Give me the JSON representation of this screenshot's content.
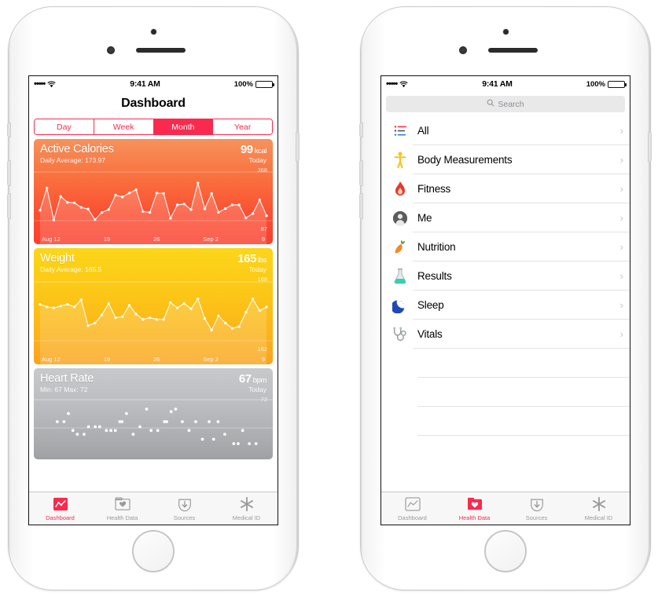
{
  "phones": {
    "left": {
      "status": {
        "signal_dots": "•••••",
        "time": "9:41 AM",
        "battery_pct": "100%"
      },
      "nav_title": "Dashboard",
      "segments": [
        {
          "label": "Day",
          "active": false
        },
        {
          "label": "Week",
          "active": false
        },
        {
          "label": "Month",
          "active": true
        },
        {
          "label": "Year",
          "active": false
        }
      ],
      "cards": [
        {
          "id": "active-calories",
          "title": "Active Calories",
          "subtitle": "Daily Average: 173.97",
          "value": "99",
          "unit": "kcal",
          "when": "Today",
          "axis_max": "368",
          "axis_min": "87",
          "x_ticks": [
            "Aug 12",
            "19",
            "26",
            "Sep 2",
            "9"
          ],
          "accent": "#fb4c31"
        },
        {
          "id": "weight",
          "title": "Weight",
          "subtitle": "Daily Average: 165.5",
          "value": "165",
          "unit": "lbs",
          "when": "Today",
          "axis_max": "168",
          "axis_min": "162",
          "x_ticks": [
            "Aug 12",
            "19",
            "26",
            "Sep 2",
            "9"
          ],
          "accent": "#fcc617"
        },
        {
          "id": "heart-rate",
          "title": "Heart Rate",
          "subtitle": "Min: 67  Max: 72",
          "value": "67",
          "unit": "bpm",
          "when": "Today",
          "axis_max": "72",
          "axis_min": "",
          "x_ticks": [],
          "accent": "#a8a9ac"
        }
      ],
      "tabs": [
        {
          "label": "Dashboard",
          "icon": "dashboard-chart-icon",
          "active": true
        },
        {
          "label": "Health Data",
          "icon": "health-data-folder-icon",
          "active": false
        },
        {
          "label": "Sources",
          "icon": "sources-download-icon",
          "active": false
        },
        {
          "label": "Medical ID",
          "icon": "medical-id-asterisk-icon",
          "active": false
        }
      ]
    },
    "right": {
      "status": {
        "signal_dots": "•••••",
        "time": "9:41 AM",
        "battery_pct": "100%"
      },
      "search": {
        "placeholder": "Search",
        "value": ""
      },
      "list_items": [
        {
          "label": "All",
          "icon": "list-bullets-icon"
        },
        {
          "label": "Body Measurements",
          "icon": "body-figure-icon"
        },
        {
          "label": "Fitness",
          "icon": "flame-icon"
        },
        {
          "label": "Me",
          "icon": "person-avatar-icon"
        },
        {
          "label": "Nutrition",
          "icon": "carrot-icon"
        },
        {
          "label": "Results",
          "icon": "flask-icon"
        },
        {
          "label": "Sleep",
          "icon": "moon-icon"
        },
        {
          "label": "Vitals",
          "icon": "stethoscope-icon"
        }
      ],
      "tabs": [
        {
          "label": "Dashboard",
          "icon": "dashboard-chart-icon",
          "active": false
        },
        {
          "label": "Health Data",
          "icon": "health-data-folder-icon",
          "active": true
        },
        {
          "label": "Sources",
          "icon": "sources-download-icon",
          "active": false
        },
        {
          "label": "Medical ID",
          "icon": "medical-id-asterisk-icon",
          "active": false
        }
      ]
    }
  },
  "chart_data": [
    {
      "type": "line",
      "title": "Active Calories",
      "ylabel": "kcal",
      "ylim": [
        87,
        368
      ],
      "xlabel": "",
      "x_tick_labels": [
        "Aug 12",
        "19",
        "26",
        "Sep 2",
        "9"
      ],
      "values": [
        168,
        300,
        110,
        250,
        215,
        212,
        185,
        175,
        112,
        155,
        172,
        258,
        247,
        270,
        290,
        160,
        155,
        270,
        268,
        120,
        200,
        205,
        172,
        330,
        176,
        268,
        156,
        178,
        200,
        200,
        122,
        148,
        230,
        135
      ]
    },
    {
      "type": "line",
      "title": "Weight",
      "ylabel": "lbs",
      "ylim": [
        162,
        168
      ],
      "xlabel": "",
      "x_tick_labels": [
        "Aug 12",
        "19",
        "26",
        "Sep 2",
        "9"
      ],
      "values": [
        166.1,
        165.8,
        165.7,
        165.9,
        166.1,
        165.8,
        166.6,
        163.7,
        164.0,
        164.9,
        166.2,
        164.6,
        164.7,
        166.0,
        165.0,
        164.4,
        164.6,
        164.4,
        164.4,
        166.3,
        165.7,
        166.2,
        165.6,
        166.7,
        164.5,
        163.2,
        164.8,
        164.0,
        163.4,
        163.6,
        165.2,
        166.7,
        165.4,
        165.8
      ]
    },
    {
      "type": "scatter",
      "title": "Heart Rate",
      "ylabel": "bpm",
      "ylim": [
        66,
        73
      ],
      "xlabel": "",
      "x_tick_labels": [],
      "points": [
        [
          0.07,
          70.0
        ],
        [
          0.1,
          70.0
        ],
        [
          0.12,
          71.3
        ],
        [
          0.14,
          68.6
        ],
        [
          0.16,
          68.0
        ],
        [
          0.19,
          68.0
        ],
        [
          0.21,
          69.2
        ],
        [
          0.24,
          69.2
        ],
        [
          0.26,
          69.2
        ],
        [
          0.29,
          68.6
        ],
        [
          0.31,
          68.6
        ],
        [
          0.33,
          68.6
        ],
        [
          0.35,
          70.0
        ],
        [
          0.36,
          70.0
        ],
        [
          0.38,
          71.3
        ],
        [
          0.41,
          68.0
        ],
        [
          0.44,
          69.2
        ],
        [
          0.47,
          72.0
        ],
        [
          0.49,
          68.6
        ],
        [
          0.52,
          68.6
        ],
        [
          0.55,
          70.0
        ],
        [
          0.56,
          70.0
        ],
        [
          0.58,
          71.6
        ],
        [
          0.6,
          72.0
        ],
        [
          0.63,
          70.0
        ],
        [
          0.66,
          68.6
        ],
        [
          0.69,
          70.0
        ],
        [
          0.72,
          67.2
        ],
        [
          0.75,
          70.0
        ],
        [
          0.77,
          67.2
        ],
        [
          0.79,
          70.0
        ],
        [
          0.82,
          68.0
        ],
        [
          0.86,
          66.5
        ],
        [
          0.88,
          66.5
        ],
        [
          0.9,
          68.6
        ],
        [
          0.93,
          66.5
        ],
        [
          0.96,
          66.5
        ]
      ]
    }
  ]
}
